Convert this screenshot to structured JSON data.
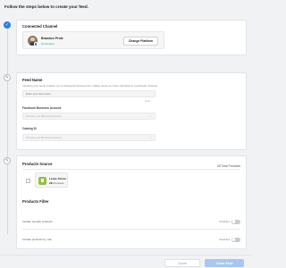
{
  "page_title": "Follow the steps below to create your feed.",
  "connected_channel": {
    "title": "Connected Channel",
    "name": "Brandon Pride",
    "status": "Connected",
    "change_button": "Change Platform",
    "status_color": "#2a9d5c"
  },
  "feed_name": {
    "title": "Feed Name",
    "help": "Labelling your feeds enables you to distinguish between the multiple feeds you have submitted to a particular Channel.",
    "placeholder": "Enter your feed name",
    "counter": "0/140",
    "business_account_label": "Facebook Business Account",
    "business_account_value": "Choose your Business Account",
    "catalog_label": "Catalog ID",
    "catalog_value": "Choose your Business Account"
  },
  "products_source": {
    "title": "Products Source",
    "total": "28 Total Products",
    "store_name": "Leslie Stores",
    "store_count": "28",
    "store_count_suffix": "Products"
  },
  "products_filter": {
    "title": "Products Filter",
    "filters": [
      {
        "label": "Include specific products",
        "state": "Disabled",
        "enabled": false
      },
      {
        "label": "Include products by rule",
        "state": "Disabled",
        "enabled": false
      }
    ]
  },
  "footer": {
    "cancel": "Cancel",
    "create": "Create Feed"
  },
  "colors": {
    "accent": "#2f7de1",
    "create_button_disabled": "#a9c7ee",
    "shopify_green": "#96bf48"
  }
}
